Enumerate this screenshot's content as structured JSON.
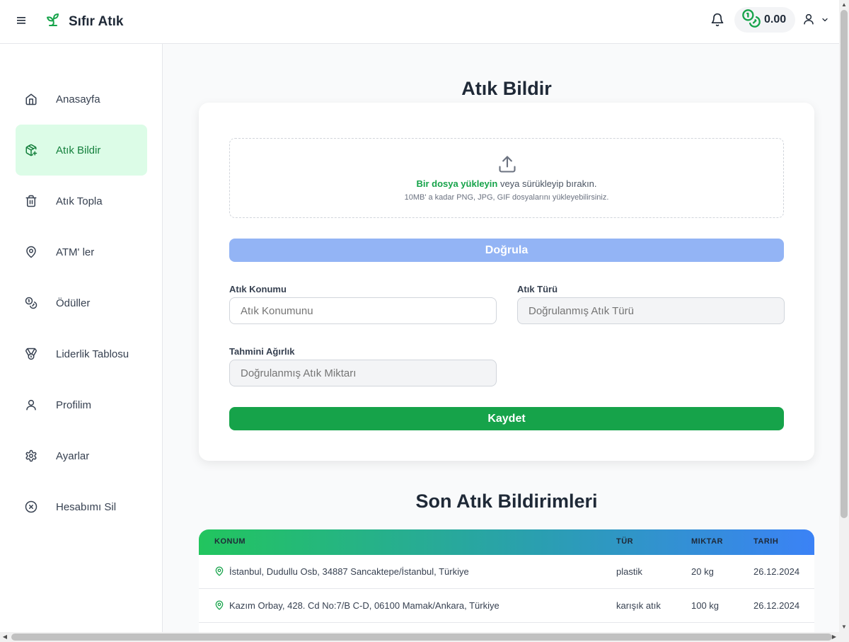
{
  "app": {
    "name": "Sıfır Atık",
    "balance": "0.00"
  },
  "sidebar": {
    "items": [
      {
        "label": "Anasayfa",
        "icon": "home-icon"
      },
      {
        "label": "Atık Bildir",
        "icon": "box-plus-icon",
        "active": true
      },
      {
        "label": "Atık Topla",
        "icon": "trash-icon"
      },
      {
        "label": "ATM' ler",
        "icon": "map-pin-icon"
      },
      {
        "label": "Ödüller",
        "icon": "coins-icon"
      },
      {
        "label": "Liderlik Tablosu",
        "icon": "medal-icon"
      },
      {
        "label": "Profilim",
        "icon": "user-icon"
      },
      {
        "label": "Ayarlar",
        "icon": "gear-icon"
      },
      {
        "label": "Hesabımı Sil",
        "icon": "circle-x-icon"
      }
    ]
  },
  "form": {
    "title": "Atık Bildir",
    "upload": {
      "link": "Bir dosya yükleyin",
      "text": " veya sürükleyip bırakın.",
      "hint": "10MB' a kadar PNG, JPG, GIF dosyalarını yükleyebilirsiniz."
    },
    "verify_label": "Doğrula",
    "location": {
      "label": "Atık Konumu",
      "placeholder": "Atık Konumunu"
    },
    "type": {
      "label": "Atık Türü",
      "placeholder": "Doğrulanmış Atık Türü"
    },
    "weight": {
      "label": "Tahmini Ağırlık",
      "placeholder": "Doğrulanmış Atık Miktarı"
    },
    "save_label": "Kaydet"
  },
  "reports": {
    "title": "Son Atık Bildirimleri",
    "headers": [
      "KONUM",
      "TÜR",
      "MIKTAR",
      "TARIH"
    ],
    "rows": [
      {
        "location": "İstanbul, Dudullu Osb, 34887 Sancaktepe/İstanbul, Türkiye",
        "type": "plastik",
        "amount": "20 kg",
        "date": "26.12.2024"
      },
      {
        "location": "Kazım Orbay, 428. Cd No:7/B C-D, 06100 Mamak/Ankara, Türkiye",
        "type": "karışık atık",
        "amount": "100 kg",
        "date": "26.12.2024"
      }
    ]
  },
  "colors": {
    "accent": "#16a34a",
    "active_bg": "#dcfce7",
    "verify": "#93b4f5",
    "gradient_start": "#22c55e",
    "gradient_end": "#3b82f6"
  }
}
